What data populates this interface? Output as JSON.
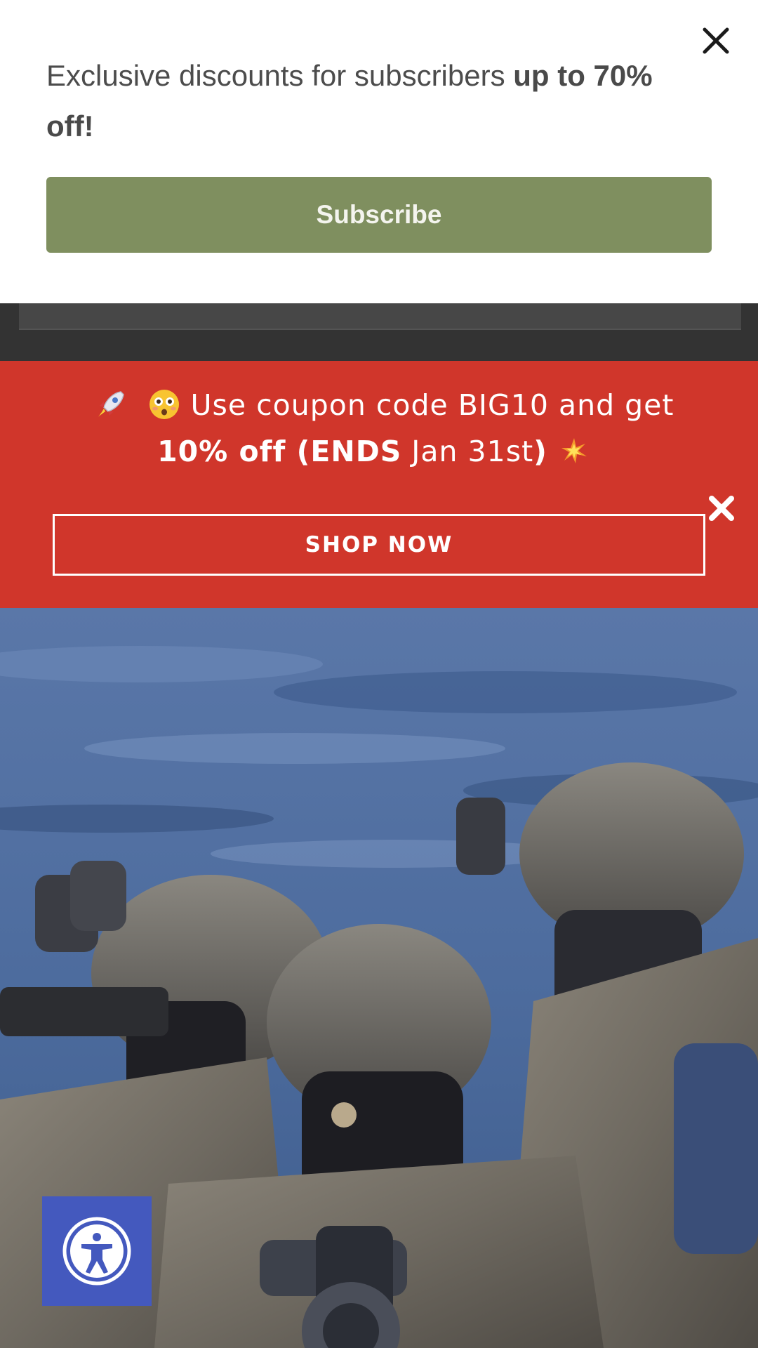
{
  "subscribe_popup": {
    "message_regular": "Exclusive discounts for subscribers ",
    "message_bold": "up to 70% off!",
    "button_label": "Subscribe",
    "close_icon": "close-icon"
  },
  "promo_banner": {
    "line1_text": "Use coupon code BIG10  and get",
    "line2_bold_a": "10% off (",
    "line2_bold_b": "ENDS",
    "line2_regular": " Jan 31st",
    "line2_bold_c": ")",
    "emoji_1": "rocket-icon",
    "emoji_2": "flushed-face-icon",
    "emoji_3": "sparkle-burst-icon",
    "button_label": "SHOP NOW",
    "close_icon": "close-icon"
  },
  "hero": {
    "image": "soldiers-with-night-vision-hero-image"
  },
  "accessibility": {
    "icon": "accessibility-icon"
  },
  "colors": {
    "subscribe_button": "#7f8f5f",
    "promo_background": "#d0362b",
    "accessibility_button": "#4459be",
    "header_dark": "#333333"
  }
}
